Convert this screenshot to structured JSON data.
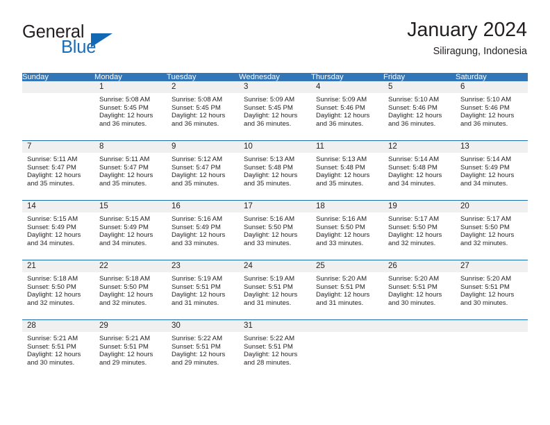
{
  "brand": {
    "word1": "General",
    "word2": "Blue",
    "triangle_color": "#1268b3",
    "blue_text_color": "#1b6cb5"
  },
  "header": {
    "title": "January 2024",
    "subtitle": "Siliragung, Indonesia",
    "header_bg_color": "#3376b8",
    "separator_color": "#1a6bb2",
    "daynum_bg_color": "#f0f0f0"
  },
  "weekday_headers": [
    "Sunday",
    "Monday",
    "Tuesday",
    "Wednesday",
    "Thursday",
    "Friday",
    "Saturday"
  ],
  "weeks": [
    [
      {
        "day": "",
        "sunrise": "",
        "sunset": "",
        "daylight1": "",
        "daylight2": ""
      },
      {
        "day": "1",
        "sunrise": "Sunrise: 5:08 AM",
        "sunset": "Sunset: 5:45 PM",
        "daylight1": "Daylight: 12 hours",
        "daylight2": "and 36 minutes."
      },
      {
        "day": "2",
        "sunrise": "Sunrise: 5:08 AM",
        "sunset": "Sunset: 5:45 PM",
        "daylight1": "Daylight: 12 hours",
        "daylight2": "and 36 minutes."
      },
      {
        "day": "3",
        "sunrise": "Sunrise: 5:09 AM",
        "sunset": "Sunset: 5:45 PM",
        "daylight1": "Daylight: 12 hours",
        "daylight2": "and 36 minutes."
      },
      {
        "day": "4",
        "sunrise": "Sunrise: 5:09 AM",
        "sunset": "Sunset: 5:46 PM",
        "daylight1": "Daylight: 12 hours",
        "daylight2": "and 36 minutes."
      },
      {
        "day": "5",
        "sunrise": "Sunrise: 5:10 AM",
        "sunset": "Sunset: 5:46 PM",
        "daylight1": "Daylight: 12 hours",
        "daylight2": "and 36 minutes."
      },
      {
        "day": "6",
        "sunrise": "Sunrise: 5:10 AM",
        "sunset": "Sunset: 5:46 PM",
        "daylight1": "Daylight: 12 hours",
        "daylight2": "and 36 minutes."
      }
    ],
    [
      {
        "day": "7",
        "sunrise": "Sunrise: 5:11 AM",
        "sunset": "Sunset: 5:47 PM",
        "daylight1": "Daylight: 12 hours",
        "daylight2": "and 35 minutes."
      },
      {
        "day": "8",
        "sunrise": "Sunrise: 5:11 AM",
        "sunset": "Sunset: 5:47 PM",
        "daylight1": "Daylight: 12 hours",
        "daylight2": "and 35 minutes."
      },
      {
        "day": "9",
        "sunrise": "Sunrise: 5:12 AM",
        "sunset": "Sunset: 5:47 PM",
        "daylight1": "Daylight: 12 hours",
        "daylight2": "and 35 minutes."
      },
      {
        "day": "10",
        "sunrise": "Sunrise: 5:13 AM",
        "sunset": "Sunset: 5:48 PM",
        "daylight1": "Daylight: 12 hours",
        "daylight2": "and 35 minutes."
      },
      {
        "day": "11",
        "sunrise": "Sunrise: 5:13 AM",
        "sunset": "Sunset: 5:48 PM",
        "daylight1": "Daylight: 12 hours",
        "daylight2": "and 35 minutes."
      },
      {
        "day": "12",
        "sunrise": "Sunrise: 5:14 AM",
        "sunset": "Sunset: 5:48 PM",
        "daylight1": "Daylight: 12 hours",
        "daylight2": "and 34 minutes."
      },
      {
        "day": "13",
        "sunrise": "Sunrise: 5:14 AM",
        "sunset": "Sunset: 5:49 PM",
        "daylight1": "Daylight: 12 hours",
        "daylight2": "and 34 minutes."
      }
    ],
    [
      {
        "day": "14",
        "sunrise": "Sunrise: 5:15 AM",
        "sunset": "Sunset: 5:49 PM",
        "daylight1": "Daylight: 12 hours",
        "daylight2": "and 34 minutes."
      },
      {
        "day": "15",
        "sunrise": "Sunrise: 5:15 AM",
        "sunset": "Sunset: 5:49 PM",
        "daylight1": "Daylight: 12 hours",
        "daylight2": "and 34 minutes."
      },
      {
        "day": "16",
        "sunrise": "Sunrise: 5:16 AM",
        "sunset": "Sunset: 5:49 PM",
        "daylight1": "Daylight: 12 hours",
        "daylight2": "and 33 minutes."
      },
      {
        "day": "17",
        "sunrise": "Sunrise: 5:16 AM",
        "sunset": "Sunset: 5:50 PM",
        "daylight1": "Daylight: 12 hours",
        "daylight2": "and 33 minutes."
      },
      {
        "day": "18",
        "sunrise": "Sunrise: 5:16 AM",
        "sunset": "Sunset: 5:50 PM",
        "daylight1": "Daylight: 12 hours",
        "daylight2": "and 33 minutes."
      },
      {
        "day": "19",
        "sunrise": "Sunrise: 5:17 AM",
        "sunset": "Sunset: 5:50 PM",
        "daylight1": "Daylight: 12 hours",
        "daylight2": "and 32 minutes."
      },
      {
        "day": "20",
        "sunrise": "Sunrise: 5:17 AM",
        "sunset": "Sunset: 5:50 PM",
        "daylight1": "Daylight: 12 hours",
        "daylight2": "and 32 minutes."
      }
    ],
    [
      {
        "day": "21",
        "sunrise": "Sunrise: 5:18 AM",
        "sunset": "Sunset: 5:50 PM",
        "daylight1": "Daylight: 12 hours",
        "daylight2": "and 32 minutes."
      },
      {
        "day": "22",
        "sunrise": "Sunrise: 5:18 AM",
        "sunset": "Sunset: 5:50 PM",
        "daylight1": "Daylight: 12 hours",
        "daylight2": "and 32 minutes."
      },
      {
        "day": "23",
        "sunrise": "Sunrise: 5:19 AM",
        "sunset": "Sunset: 5:51 PM",
        "daylight1": "Daylight: 12 hours",
        "daylight2": "and 31 minutes."
      },
      {
        "day": "24",
        "sunrise": "Sunrise: 5:19 AM",
        "sunset": "Sunset: 5:51 PM",
        "daylight1": "Daylight: 12 hours",
        "daylight2": "and 31 minutes."
      },
      {
        "day": "25",
        "sunrise": "Sunrise: 5:20 AM",
        "sunset": "Sunset: 5:51 PM",
        "daylight1": "Daylight: 12 hours",
        "daylight2": "and 31 minutes."
      },
      {
        "day": "26",
        "sunrise": "Sunrise: 5:20 AM",
        "sunset": "Sunset: 5:51 PM",
        "daylight1": "Daylight: 12 hours",
        "daylight2": "and 30 minutes."
      },
      {
        "day": "27",
        "sunrise": "Sunrise: 5:20 AM",
        "sunset": "Sunset: 5:51 PM",
        "daylight1": "Daylight: 12 hours",
        "daylight2": "and 30 minutes."
      }
    ],
    [
      {
        "day": "28",
        "sunrise": "Sunrise: 5:21 AM",
        "sunset": "Sunset: 5:51 PM",
        "daylight1": "Daylight: 12 hours",
        "daylight2": "and 30 minutes."
      },
      {
        "day": "29",
        "sunrise": "Sunrise: 5:21 AM",
        "sunset": "Sunset: 5:51 PM",
        "daylight1": "Daylight: 12 hours",
        "daylight2": "and 29 minutes."
      },
      {
        "day": "30",
        "sunrise": "Sunrise: 5:22 AM",
        "sunset": "Sunset: 5:51 PM",
        "daylight1": "Daylight: 12 hours",
        "daylight2": "and 29 minutes."
      },
      {
        "day": "31",
        "sunrise": "Sunrise: 5:22 AM",
        "sunset": "Sunset: 5:51 PM",
        "daylight1": "Daylight: 12 hours",
        "daylight2": "and 28 minutes."
      },
      {
        "day": "",
        "sunrise": "",
        "sunset": "",
        "daylight1": "",
        "daylight2": ""
      },
      {
        "day": "",
        "sunrise": "",
        "sunset": "",
        "daylight1": "",
        "daylight2": ""
      },
      {
        "day": "",
        "sunrise": "",
        "sunset": "",
        "daylight1": "",
        "daylight2": ""
      }
    ]
  ]
}
